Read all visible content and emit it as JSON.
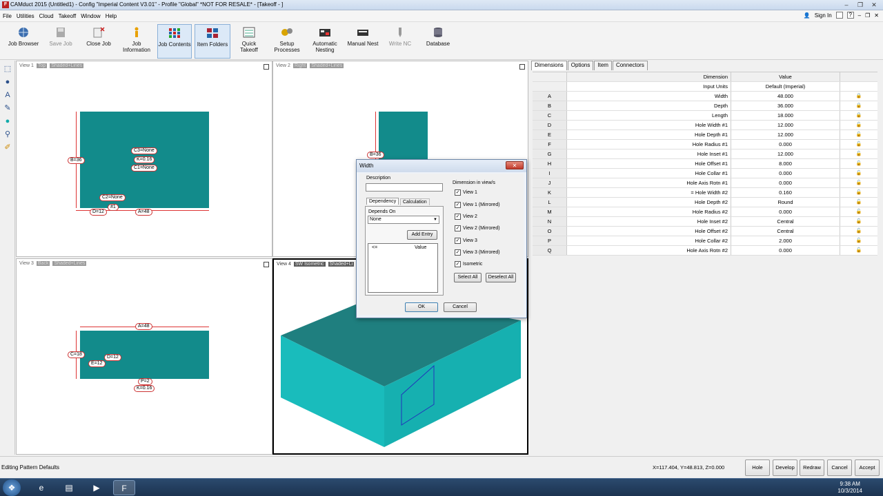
{
  "window": {
    "title": "CAMduct 2015 (Untitled1) - Config \"Imperial Content V3.01\" - Profile \"Global\" *NOT FOR RESALE* - [Takeoff - ]",
    "min": "–",
    "restore": "❐",
    "close": "✕"
  },
  "menu": {
    "items": [
      "File",
      "Utilities",
      "Cloud",
      "Takeoff",
      "Window",
      "Help"
    ],
    "sign_in": "Sign In"
  },
  "toolbar": {
    "items": [
      {
        "label": "Job Browser",
        "state": "normal"
      },
      {
        "label": "Save Job",
        "state": "disabled"
      },
      {
        "label": "Close Job",
        "state": "normal"
      },
      {
        "label": "Job Information",
        "state": "normal"
      },
      {
        "label": "Job Contents",
        "state": "active"
      },
      {
        "label": "Item Folders",
        "state": "active"
      },
      {
        "label": "Quick Takeoff",
        "state": "normal"
      },
      {
        "label": "Setup Processes",
        "state": "normal"
      },
      {
        "label": "Automatic Nesting",
        "state": "normal"
      },
      {
        "label": "Manual Nest",
        "state": "normal"
      },
      {
        "label": "Write NC",
        "state": "disabled"
      },
      {
        "label": "Database",
        "state": "normal"
      }
    ]
  },
  "views": {
    "v1": {
      "name": "View 1",
      "tag1": "Top",
      "tag2": "Shaded+Lines",
      "dims": [
        "B=36",
        "C3=None",
        "K=0.16",
        "C1=None",
        "C2=None",
        "#1",
        "D=12",
        "A=48"
      ]
    },
    "v2": {
      "name": "View 2",
      "tag1": "Right",
      "tag2": "Shaded+Lines",
      "dims": [
        "B=36"
      ]
    },
    "v3": {
      "name": "View 3",
      "tag1": "Back",
      "tag2": "Shaded+Lines",
      "dims": [
        "A=48",
        "C=18",
        "D=12",
        "E=12",
        "P=2",
        "K=0.16"
      ]
    },
    "v4": {
      "name": "View 4",
      "tag1": "SW Isometric",
      "tag2": "Shaded+Li"
    }
  },
  "dialog": {
    "title": "Width",
    "close": "✕",
    "description_label": "Description",
    "description_value": "",
    "tab_dependency": "Dependency",
    "tab_calculation": "Calculation",
    "depends_on_label": "Depends On",
    "depends_on_value": "None",
    "add_entry": "Add Entry",
    "list_col1": "<=",
    "list_col2": "Value",
    "dim_in_views_label": "Dimension in view/s",
    "checkboxes": [
      "View 1",
      "View 1 (Mirrored)",
      "View 2",
      "View 2 (Mirrored)",
      "View 3",
      "View 3 (Mirrored)",
      "Isometric"
    ],
    "select_all": "Select All",
    "deselect_all": "Deselect All",
    "ok": "OK",
    "cancel": "Cancel"
  },
  "panel": {
    "tabs": [
      "Dimensions",
      "Options",
      "Item",
      "Connectors"
    ],
    "header": {
      "dimension": "Dimension",
      "value": "Value",
      "units_label": "Input Units",
      "units_value": "Default (Imperial)"
    },
    "rows": [
      {
        "key": "A",
        "name": "Width",
        "value": "48.000",
        "lock": "locked"
      },
      {
        "key": "B",
        "name": "Depth",
        "value": "36.000",
        "lock": "locked"
      },
      {
        "key": "C",
        "name": "Length",
        "value": "18.000",
        "lock": "locked"
      },
      {
        "key": "D",
        "name": "Hole Width #1",
        "value": "12.000",
        "lock": "unlocked"
      },
      {
        "key": "E",
        "name": "Hole Depth #1",
        "value": "12.000",
        "lock": "unlocked"
      },
      {
        "key": "F",
        "name": "Hole Radius #1",
        "value": "0.000",
        "lock": "unlocked"
      },
      {
        "key": "G",
        "name": "Hole Inset #1",
        "value": "12.000",
        "lock": "unlocked"
      },
      {
        "key": "H",
        "name": "Hole Offset #1",
        "value": "8.000",
        "lock": "unlocked"
      },
      {
        "key": "I",
        "name": "Hole Collar #1",
        "value": "0.000",
        "lock": "unlocked"
      },
      {
        "key": "J",
        "name": "Hole Axis Rotn #1",
        "value": "0.000",
        "lock": "unlocked"
      },
      {
        "key": "K",
        "name": "= Hole Width #2",
        "value": "0.160",
        "lock": "unlocked"
      },
      {
        "key": "L",
        "name": "Hole Depth #2",
        "value": "Round",
        "lock": "unlocked"
      },
      {
        "key": "M",
        "name": "Hole Radius #2",
        "value": "0.000",
        "lock": "unlocked"
      },
      {
        "key": "N",
        "name": "Hole Inset #2",
        "value": "Central",
        "lock": "unlocked"
      },
      {
        "key": "O",
        "name": "Hole Offset #2",
        "value": "Central",
        "lock": "unlocked"
      },
      {
        "key": "P",
        "name": "Hole Collar #2",
        "value": "2.000",
        "lock": "unlocked"
      },
      {
        "key": "Q",
        "name": "Hole Axis Rotn #2",
        "value": "0.000",
        "lock": "unlocked"
      }
    ]
  },
  "status": {
    "message": "Editing Pattern Defaults",
    "coords": "X=117.404, Y=48.813, Z=0.000",
    "buttons": [
      "Hole",
      "Develop",
      "Redraw",
      "Cancel",
      "Accept"
    ]
  },
  "taskbar": {
    "time": "9:38 AM",
    "date": "10/3/2014"
  },
  "colors": {
    "teal": "#128b8b",
    "iso_top": "#1f7f7f",
    "iso_side": "#19bcbc",
    "dim_border": "#cc3333"
  }
}
